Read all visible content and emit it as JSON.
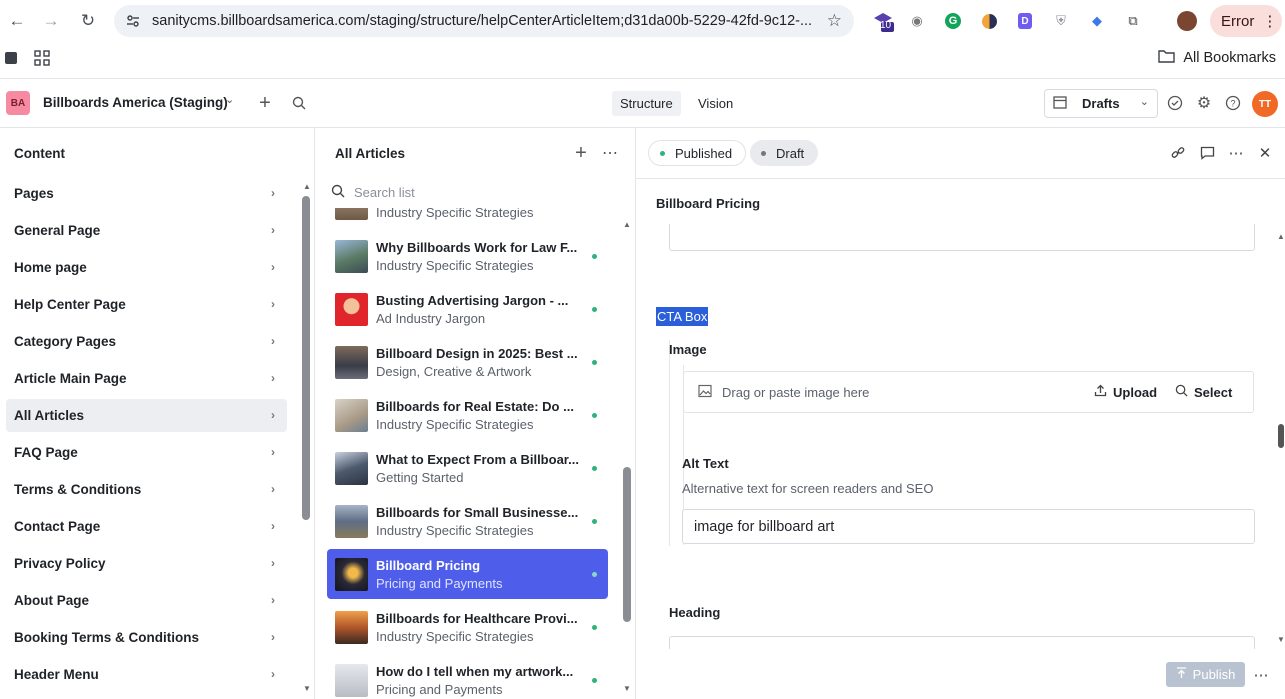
{
  "browser": {
    "url": "sanitycms.billboardsamerica.com/staging/structure/helpCenterArticleItem;d31da00b-5229-42fd-9c12-...",
    "extension_badge": "10",
    "error_label": "Error",
    "bookmarks_label": "All Bookmarks"
  },
  "appbar": {
    "workspace_initials": "BA",
    "workspace_name": "Billboards America (Staging)",
    "tab_structure": "Structure",
    "tab_vision": "Vision",
    "perspective": "Drafts",
    "user_initials": "TT"
  },
  "content_pane": {
    "title": "Content",
    "items": [
      {
        "label": "Pages"
      },
      {
        "label": "General Page"
      },
      {
        "label": "Home page"
      },
      {
        "label": "Help Center Page"
      },
      {
        "label": "Category Pages"
      },
      {
        "label": "Article Main Page"
      },
      {
        "label": "All Articles",
        "active": true
      },
      {
        "label": "FAQ Page"
      },
      {
        "label": "Terms & Conditions"
      },
      {
        "label": "Contact Page"
      },
      {
        "label": "Privacy Policy"
      },
      {
        "label": "About Page"
      },
      {
        "label": "Booking Terms & Conditions"
      },
      {
        "label": "Header Menu"
      }
    ]
  },
  "articles_pane": {
    "title": "All Articles",
    "search_placeholder": "Search list",
    "partial_top_subtitle": "Industry Specific Strategies",
    "items": [
      {
        "title": "Why Billboards Work for Law F...",
        "subtitle": "Industry Specific Strategies"
      },
      {
        "title": "Busting Advertising Jargon - ...",
        "subtitle": "Ad Industry Jargon"
      },
      {
        "title": "Billboard Design in 2025: Best ...",
        "subtitle": "Design, Creative & Artwork"
      },
      {
        "title": "Billboards for Real Estate: Do ...",
        "subtitle": "Industry Specific Strategies"
      },
      {
        "title": "What to Expect From a Billboar...",
        "subtitle": "Getting Started"
      },
      {
        "title": "Billboards for Small Businesse...",
        "subtitle": "Industry Specific Strategies"
      },
      {
        "title": "Billboard Pricing",
        "subtitle": "Pricing and Payments",
        "selected": true
      },
      {
        "title": "Billboards for Healthcare Provi...",
        "subtitle": "Industry Specific Strategies"
      },
      {
        "title": "How do I tell when my artwork...",
        "subtitle": "Pricing and Payments"
      }
    ]
  },
  "editor": {
    "status_published": "Published",
    "status_draft": "Draft",
    "field_title_label": "Billboard Pricing",
    "cta_box_label": "CTA Box",
    "image_label": "Image",
    "image_drop_placeholder": "Drag or paste image here",
    "upload_label": "Upload",
    "select_label": "Select",
    "alt_text_label": "Alt Text",
    "alt_text_description": "Alternative text for screen readers and SEO",
    "alt_text_value": "image for billboard art",
    "heading_label": "Heading",
    "publish_label": "Publish"
  }
}
